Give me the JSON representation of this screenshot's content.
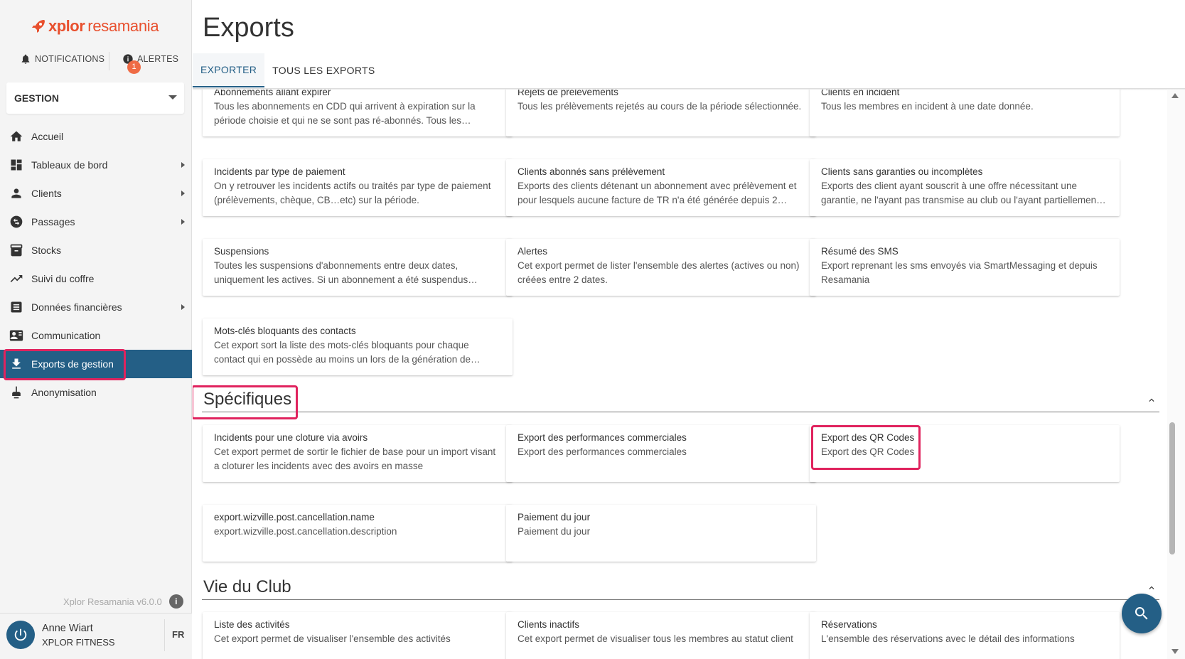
{
  "app": {
    "brand_xplor": "xplor",
    "brand_resamania": "resamania",
    "version": "Xplor Resamania v6.0.0"
  },
  "topbar": {
    "notifications_label": "NOTIFICATIONS",
    "alerts_label": "ALERTES",
    "alerts_count": "1"
  },
  "module_select": {
    "value": "GESTION"
  },
  "nav": {
    "items": [
      {
        "label": "Accueil",
        "icon": "home-icon",
        "has_submenu": false
      },
      {
        "label": "Tableaux de bord",
        "icon": "dashboard-icon",
        "has_submenu": true
      },
      {
        "label": "Clients",
        "icon": "person-icon",
        "has_submenu": true
      },
      {
        "label": "Passages",
        "icon": "swap-icon",
        "has_submenu": true
      },
      {
        "label": "Stocks",
        "icon": "inventory-icon",
        "has_submenu": false
      },
      {
        "label": "Suivi du coffre",
        "icon": "trending-icon",
        "has_submenu": false
      },
      {
        "label": "Données financières",
        "icon": "list-icon",
        "has_submenu": true
      },
      {
        "label": "Communication",
        "icon": "contact-card-icon",
        "has_submenu": false
      },
      {
        "label": "Exports de gestion",
        "icon": "download-icon",
        "has_submenu": false,
        "active": true
      },
      {
        "label": "Anonymisation",
        "icon": "broom-icon",
        "has_submenu": false
      }
    ]
  },
  "user": {
    "name": "Anne Wiart",
    "company": "XPLOR FITNESS",
    "lang": "FR"
  },
  "page": {
    "title": "Exports",
    "tabs": [
      {
        "label": "EXPORTER",
        "active": true
      },
      {
        "label": "TOUS LES EXPORTS",
        "active": false
      }
    ]
  },
  "cards_gestion": [
    {
      "title": "Abonnements allant expirer",
      "desc": "Tous les abonnements en CDD qui arrivent à expiration sur la période choisie et qui ne se sont pas ré-abonnés. Tous les…"
    },
    {
      "title": "Rejets de prélèvements",
      "desc": "Tous les prélèvements rejetés au cours de la période sélectionnée."
    },
    {
      "title": "Clients en incident",
      "desc": "Tous les membres en incident à une date donnée."
    },
    {
      "title": "Incidents par type de paiement",
      "desc": "On y retrouver les incidents actifs ou traités par type de paiement (prélèvements, chèque, CB…etc) sur la période."
    },
    {
      "title": "Clients abonnés sans prélèvement",
      "desc": "Exports des clients détenant un abonnement avec prélèvement et pour lesquels aucune facture de TR n'a été générée depuis 2…"
    },
    {
      "title": "Clients sans garanties ou incomplètes",
      "desc": "Exports des client ayant souscrit à une offre nécessitant une garantie, ne l'ayant pas transmise au club ou l'ayant partiellemen…"
    },
    {
      "title": "Suspensions",
      "desc": "Toutes les suspensions d'abonnements entre deux dates, uniquement les actives. Si un abonnement a été suspendus…"
    },
    {
      "title": "Alertes",
      "desc": "Cet export permet de lister l'ensemble des alertes (actives ou non) créées entre 2 dates."
    },
    {
      "title": "Résumé des SMS",
      "desc": "Export reprenant les sms envoyés via SmartMessaging et depuis Resamania"
    },
    {
      "title": "Mots-clés bloquants des contacts",
      "desc": "Cet export sort la liste des mots-clés bloquants pour chaque contact qui en possède au moins un lors de la génération de…"
    }
  ],
  "section_specifiques": {
    "title": "Spécifiques",
    "cards": [
      {
        "title": "Incidents pour une cloture via avoirs",
        "desc": "Cet export permet de sortir le fichier de base pour un import visant a cloturer les incidents avec des avoirs en masse"
      },
      {
        "title": "Export des performances commerciales",
        "desc": "Export des performances commerciales"
      },
      {
        "title": "Export des QR Codes",
        "desc": "Export des QR Codes"
      },
      {
        "title": "export.wizville.post.cancellation.name",
        "desc": "export.wizville.post.cancellation.description"
      },
      {
        "title": "Paiement du jour",
        "desc": "Paiement du jour"
      }
    ]
  },
  "section_vie_club": {
    "title": "Vie du Club",
    "cards": [
      {
        "title": "Liste des activités",
        "desc": "Cet export permet de visualiser l'ensemble des activités"
      },
      {
        "title": "Clients inactifs",
        "desc": "Cet export permet de visualiser tous les membres au statut client"
      },
      {
        "title": "Réservations",
        "desc": "L'ensemble des réservations avec le détail des informations"
      }
    ]
  },
  "colors": {
    "primary": "#245f86",
    "brand_orange": "#e8502e",
    "highlight": "#e0235e",
    "badge": "#ef6b45"
  }
}
